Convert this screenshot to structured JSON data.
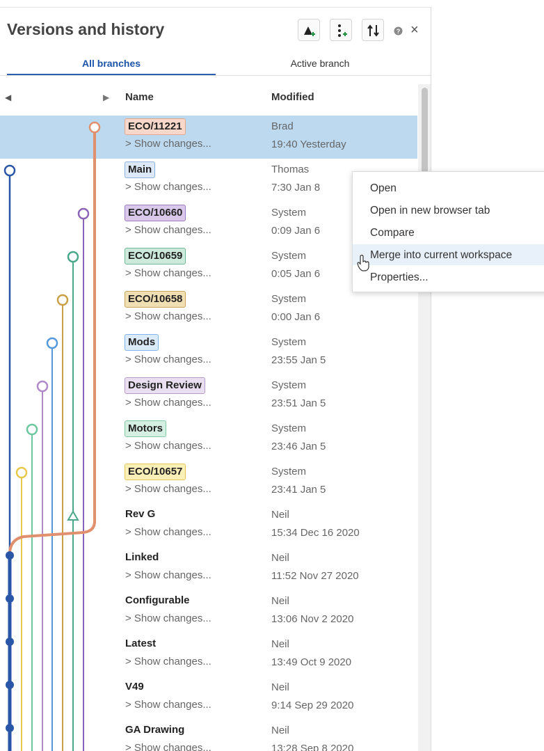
{
  "header": {
    "title": "Versions and history",
    "buttons": [
      {
        "name": "create-version-button",
        "icon": "version-add-icon"
      },
      {
        "name": "create-branch-button",
        "icon": "branch-add-icon"
      },
      {
        "name": "compare-button",
        "icon": "swap-icon"
      }
    ],
    "help_icon": "help-icon",
    "close_label": "×"
  },
  "tabs": [
    {
      "label": "All branches",
      "active": true
    },
    {
      "label": "Active branch",
      "active": false
    }
  ],
  "columns": {
    "name": "Name",
    "modified": "Modified"
  },
  "rows": [
    {
      "name": "ECO/11221",
      "tag_color": "#f6d7c9",
      "tag_border": "#e0a98c",
      "show": "> Show changes...",
      "user": "Brad",
      "time": "19:40 Yesterday",
      "selected": true
    },
    {
      "name": "Main",
      "tag_color": "#dde9f8",
      "tag_border": "#8fb1de",
      "show": "> Show changes...",
      "user": "Thomas",
      "time": "7:30 Jan 8"
    },
    {
      "name": "ECO/10660",
      "tag_color": "#d9c8ea",
      "tag_border": "#9a7cc0",
      "show": "> Show changes...",
      "user": "System",
      "time": "0:09 Jan 6"
    },
    {
      "name": "ECO/10659",
      "tag_color": "#cdeadd",
      "tag_border": "#6fb798",
      "show": "> Show changes...",
      "user": "System",
      "time": "0:05 Jan 6"
    },
    {
      "name": "ECO/10658",
      "tag_color": "#f0dfb2",
      "tag_border": "#c7a55a",
      "show": "> Show changes...",
      "user": "System",
      "time": "0:00 Jan 6"
    },
    {
      "name": "Mods",
      "tag_color": "#dcebfb",
      "tag_border": "#7fb2e8",
      "show": "> Show changes...",
      "user": "System",
      "time": "23:55 Jan 5"
    },
    {
      "name": "Design Review",
      "tag_color": "#eadff0",
      "tag_border": "#b79ac8",
      "show": "> Show changes...",
      "user": "System",
      "time": "23:51 Jan 5"
    },
    {
      "name": "Motors",
      "tag_color": "#d5f0e2",
      "tag_border": "#7fc8a2",
      "show": "> Show changes...",
      "user": "System",
      "time": "23:46 Jan 5"
    },
    {
      "name": "ECO/10657",
      "tag_color": "#fbefb8",
      "tag_border": "#e3c55a",
      "show": "> Show changes...",
      "user": "System",
      "time": "23:41 Jan 5"
    },
    {
      "name": "Rev G",
      "show": "> Show changes...",
      "user": "Neil",
      "time": "15:34 Dec 16 2020"
    },
    {
      "name": "Linked",
      "show": "> Show changes...",
      "user": "Neil",
      "time": "11:52 Nov 27 2020"
    },
    {
      "name": "Configurable",
      "show": "> Show changes...",
      "user": "Neil",
      "time": "13:06 Nov 2 2020"
    },
    {
      "name": "Latest",
      "show": "> Show changes...",
      "user": "Neil",
      "time": "13:49 Oct 9 2020"
    },
    {
      "name": "V49",
      "show": "> Show changes...",
      "user": "Neil",
      "time": "9:14 Sep 29 2020"
    },
    {
      "name": "GA Drawing",
      "show": "> Show changes...",
      "user": "Neil",
      "time": "13:28 Sep 8 2020"
    }
  ],
  "context_menu": {
    "items": [
      "Open",
      "Open in new browser tab",
      "Compare",
      "Merge into current workspace",
      "Properties..."
    ],
    "highlighted": "Merge into current workspace"
  },
  "branch_colors": {
    "main": "#2a56a8",
    "eco11221": "#e0906c",
    "eco10660": "#8d63b8",
    "eco10659": "#4aa78a",
    "eco10658": "#c9a045",
    "mods": "#5599dd",
    "design_review": "#b08ac8",
    "motors": "#6cc79e",
    "eco10657": "#e8c84a"
  }
}
